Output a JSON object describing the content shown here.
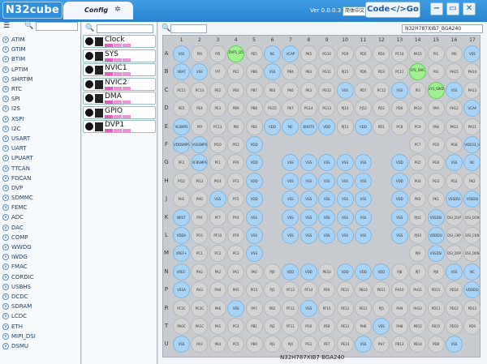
{
  "app": {
    "logo": "N32cube",
    "config_tab": "Config",
    "version": "Ver 0.0.0.3",
    "language": "简体中文",
    "code_go": "Code</>Go"
  },
  "window_buttons": [
    "−",
    "▭",
    "✕"
  ],
  "modules": [
    "ATIM",
    "GTIM",
    "BTIM",
    "LPTIM",
    "SHRTIM",
    "RTC",
    "SPI",
    "I2S",
    "XSPI",
    "I2C",
    "USART",
    "UART",
    "LPUART",
    "TTCAN",
    "FDCAN",
    "DVP",
    "SDMMC",
    "FEMC",
    "ADC",
    "DAC",
    "COMP",
    "WWDG",
    "IWDG",
    "FMAC",
    "CORDIC",
    "USBHS",
    "DCDC",
    "SDRAM",
    "LCDC",
    "ETH",
    "MIPI_DSI",
    "DSMU"
  ],
  "system_modules": [
    {
      "name": "Clock",
      "icon": "clock"
    },
    {
      "name": "SYS",
      "icon": "sys"
    },
    {
      "name": "NVIC1",
      "icon": "nvic"
    },
    {
      "name": "NVIC2",
      "icon": "nvic"
    },
    {
      "name": "DMA",
      "icon": "dma"
    },
    {
      "name": "GPIO",
      "icon": "gpio"
    },
    {
      "name": "DVP1",
      "icon": "dvp"
    }
  ],
  "part_number": "N32H787XIB7_BGA240",
  "package_label": "N32H787XIB7 BGA240",
  "columns": [
    "1",
    "2",
    "3",
    "4",
    "5",
    "6",
    "7",
    "8",
    "9",
    "10",
    "11",
    "12",
    "13",
    "14",
    "15",
    "16",
    "17"
  ],
  "rows": [
    "A",
    "B",
    "C",
    "D",
    "E",
    "F",
    "G",
    "H",
    "J",
    "K",
    "L",
    "M",
    "N",
    "P",
    "R",
    "T",
    "U"
  ],
  "pins": [
    [
      "VSS",
      "PI6",
      "PI5",
      "DVP1_D5",
      "PE5",
      "NC",
      "VCAP",
      "PK5",
      "PG10",
      "PG9",
      "PD5",
      "PD4",
      "PC10",
      "PA15",
      "PI1",
      "PI0",
      "VSS"
    ],
    [
      "VBAT",
      "VSS",
      "PI7",
      "PE1",
      "PB6",
      "VSS",
      "PB4",
      "PK4",
      "PG11",
      "PJ15",
      "PD6",
      "PD3",
      "PC11",
      "SYS_SWCLK",
      "PI2",
      "PH15",
      "PH14"
    ],
    [
      "PC15",
      "PC14",
      "PE2",
      "PE0",
      "PB7",
      "PB3",
      "PK6",
      "PK3",
      "PG12",
      "VSS",
      "PD7",
      "PC12",
      "VSS",
      "PI3",
      "SYS_SWDIO",
      "VSS",
      "PH13"
    ],
    [
      "PE5",
      "PE4",
      "PE3",
      "PB9",
      "PB8",
      "PG15",
      "PK7",
      "PG14",
      "PG13",
      "PJ14",
      "PJ12",
      "PD2",
      "PD0",
      "PA10",
      "PA9",
      "PH12",
      "VCAP"
    ],
    [
      "VLSMPS",
      "PI9",
      "PC13",
      "PI8",
      "PE6",
      "VDD",
      "NC",
      "BOOT0",
      "VDD",
      "PJ13",
      "VDD",
      "PD1",
      "PC8",
      "PC9",
      "PA8",
      "PA12",
      "PA11"
    ],
    [
      "VDDSMPS",
      "VSSSMPS",
      "PI10",
      "PI11",
      "VDD",
      "",
      "",
      "",
      "",
      "",
      "",
      "",
      "",
      "PC7",
      "PC6",
      "PG8",
      "VDD33_USB"
    ],
    [
      "PF2",
      "VFBSMPS",
      "PF1",
      "PF0",
      "VDD",
      "",
      "VSS",
      "VSS",
      "VSS",
      "VSS",
      "VSS",
      "",
      "VDD",
      "PG5",
      "PG6",
      "VSS",
      "NC"
    ],
    [
      "PI12",
      "PI13",
      "PI14",
      "PF3",
      "VDD",
      "",
      "VSS",
      "VSS",
      "VSS",
      "VSS",
      "VSS",
      "",
      "VDD",
      "PG4",
      "PG3",
      "PG2",
      "PK2"
    ],
    [
      "PH1",
      "PH0",
      "VSS",
      "PF5",
      "VDD",
      "",
      "VSS",
      "VSS",
      "VSS",
      "VSS",
      "VSS",
      "",
      "VDD",
      "PK0",
      "PK1",
      "VSSDSI",
      "VSSDSI"
    ],
    [
      "NRST",
      "PF6",
      "PF7",
      "PF4",
      "VSS",
      "",
      "VSS",
      "VSS",
      "VSS",
      "VSS",
      "VSS",
      "",
      "VSS",
      "PJ11",
      "VSSDSI",
      "DSI_D1P",
      "DSI_D1N"
    ],
    [
      "VDDA",
      "PC0",
      "PF10",
      "PF9",
      "VSS",
      "",
      "VSS",
      "VSS",
      "VSS",
      "VSS",
      "VSS",
      "",
      "VSS",
      "PJ10",
      "VDDDSI",
      "DSI_CKP",
      "DSI_CKN"
    ],
    [
      "VREF+",
      "PC1",
      "PC2",
      "PC3",
      "VSS",
      "",
      "",
      "",
      "",
      "",
      "",
      "",
      "",
      "PJ9",
      "VSSDSI",
      "DSI_D0P",
      "DSI_D0N"
    ],
    [
      "VREF-",
      "PH2",
      "PA2",
      "PA1",
      "PA0",
      "PJ0",
      "VDD",
      "VDD",
      "PE10",
      "VDD",
      "VDD",
      "VDD",
      "PJ8",
      "PJ7",
      "PJ6",
      "VSS",
      "NC"
    ],
    [
      "VSSA",
      "PH3",
      "PH4",
      "PH5",
      "PI15",
      "PJ1",
      "PF13",
      "PF14",
      "PE9",
      "PE11",
      "PB10",
      "PB11",
      "PH10",
      "PH11",
      "PD15",
      "PD14",
      "VDDDSI"
    ],
    [
      "PC2C",
      "PC3C",
      "PA6",
      "VSS",
      "PA7",
      "PB2",
      "PF12",
      "VSS",
      "PF15",
      "PE12",
      "PE15",
      "PJ5",
      "PH9",
      "PH12",
      "PD11",
      "PD12",
      "PD13"
    ],
    [
      "PA0C",
      "PA1C",
      "PA5",
      "PC4",
      "PB1",
      "PJ2",
      "PF11",
      "PG0",
      "PE8",
      "PE13",
      "PH6",
      "VSS",
      "PH8",
      "PB12",
      "PB15",
      "PD10",
      "PD9"
    ],
    [
      "VSS",
      "PA3",
      "PA4",
      "PC5",
      "PB0",
      "PJ3",
      "PJ4",
      "PG1",
      "PE7",
      "PE14",
      "VSS",
      "PH7",
      "PB13",
      "PB14",
      "PD8",
      "VSS",
      ""
    ]
  ]
}
